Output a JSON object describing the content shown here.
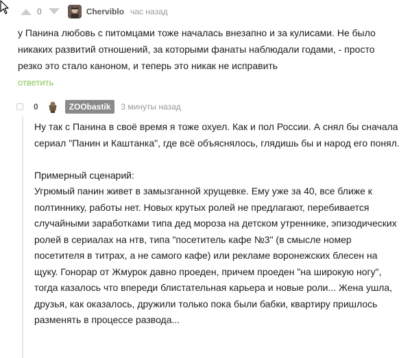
{
  "comment1": {
    "score": "0",
    "author": "Cherviblo",
    "time": "час назад",
    "text": "у Панина любовь с питомцами тоже началась внезапно и за кулисами. Не было никаких развитий отношений, за которыми фанаты наблюдали годами, - просто резко это стало каноном, и теперь это никак не исправить",
    "reply_label": "ответить",
    "upvote_icon": "upvote-arrow-icon",
    "downvote_icon": "downvote-arrow-icon"
  },
  "comment2": {
    "score": "0",
    "author": "ZOObastik",
    "time": "3 минуты назад",
    "paragraph1": "Ну так с Панина в своё время я тоже охуел. Как и пол России. А снял бы сначала сериал \"Панин и Каштанка\", где всё объяснялось, глядишь бы и народ его понял.",
    "paragraph2_title": "Примерный сценарий:",
    "paragraph2_body": "Угрюмый панин живет в замызганной хрущевке. Ему уже за 40, все ближе к полтиннику, работы нет. Новых крутых ролей не предлагают, перебивается случайными заработками типа дед мороза на детском утреннике, эпизодических ролей в сериалах на нтв, типа \"посетитель кафе №3\" (в смысле номер посетителя в титрах, а не самого кафе) или рекламе воронежских блесен на щуку. Гонорар от Жмурок давно проеден, причем проеден \"на широкую ногу\", тогда казалось что впереди блистательная карьера и новые роли... Жена ушла, друзья, как оказалось, дружили только пока были бабки, квартиру пришлось разменять в процессе развода..."
  },
  "colors": {
    "reply_link": "#8ac858",
    "name_badge_bg": "#8a8a8a",
    "vote_arrow": "#cccccc"
  }
}
